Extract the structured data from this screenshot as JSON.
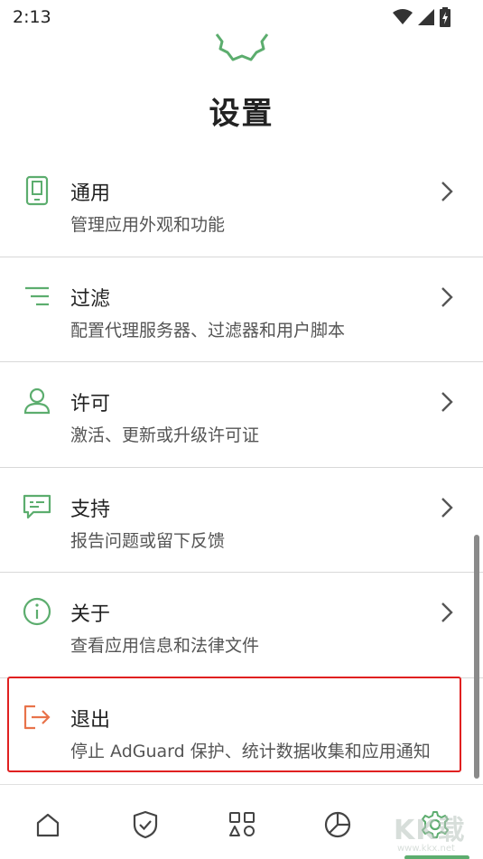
{
  "status_bar": {
    "time": "2:13"
  },
  "page": {
    "title": "设置"
  },
  "accent_color": "#5cad6e",
  "exit_color": "#e8734a",
  "highlight_color": "#e02020",
  "settings": [
    {
      "icon": "phone-icon",
      "title": "通用",
      "description": "管理应用外观和功能"
    },
    {
      "icon": "filter-lines-icon",
      "title": "过滤",
      "description": "配置代理服务器、过滤器和用户脚本"
    },
    {
      "icon": "person-icon",
      "title": "许可",
      "description": "激活、更新或升级许可证"
    },
    {
      "icon": "chat-icon",
      "title": "支持",
      "description": "报告问题或留下反馈"
    },
    {
      "icon": "info-icon",
      "title": "关于",
      "description": "查看应用信息和法律文件"
    },
    {
      "icon": "exit-icon",
      "title": "退出",
      "description": "停止 AdGuard 保护、统计数据收集和应用通知"
    }
  ],
  "bottom_nav": [
    {
      "icon": "home-icon"
    },
    {
      "icon": "shield-check-icon"
    },
    {
      "icon": "apps-icon"
    },
    {
      "icon": "pie-chart-icon"
    },
    {
      "icon": "gear-icon",
      "active": true
    }
  ],
  "watermark": {
    "text": "KK载",
    "url": "www.kkx.net"
  }
}
